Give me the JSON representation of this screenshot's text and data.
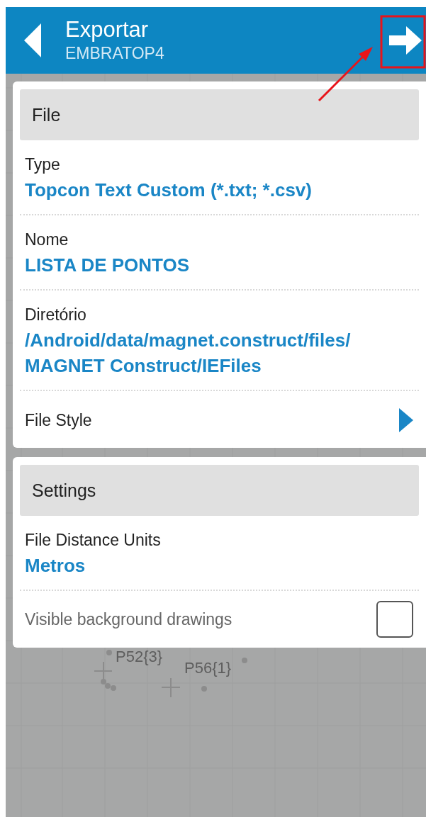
{
  "header": {
    "title": "Exportar",
    "subtitle": "EMBRATOP4"
  },
  "sections": [
    {
      "title": "File",
      "rows": [
        {
          "kind": "value",
          "label": "Type",
          "lines": [
            "Topcon Text Custom (*.txt; *.csv)"
          ]
        },
        {
          "kind": "value",
          "label": "Nome",
          "lines": [
            "LISTA DE PONTOS"
          ]
        },
        {
          "kind": "value",
          "label": "Diretório",
          "lines": [
            "/Android/data/magnet.construct/files/",
            "MAGNET Construct/IEFiles"
          ]
        },
        {
          "kind": "link",
          "label": "File Style"
        }
      ]
    },
    {
      "title": "Settings",
      "rows": [
        {
          "kind": "value",
          "label": "File Distance Units",
          "lines": [
            "Metros"
          ]
        },
        {
          "kind": "checkbox",
          "label": "Visible background drawings",
          "checked": false
        }
      ]
    }
  ],
  "map": {
    "points": [
      {
        "label": "P52{3}"
      },
      {
        "label": "P56{1}"
      }
    ]
  }
}
